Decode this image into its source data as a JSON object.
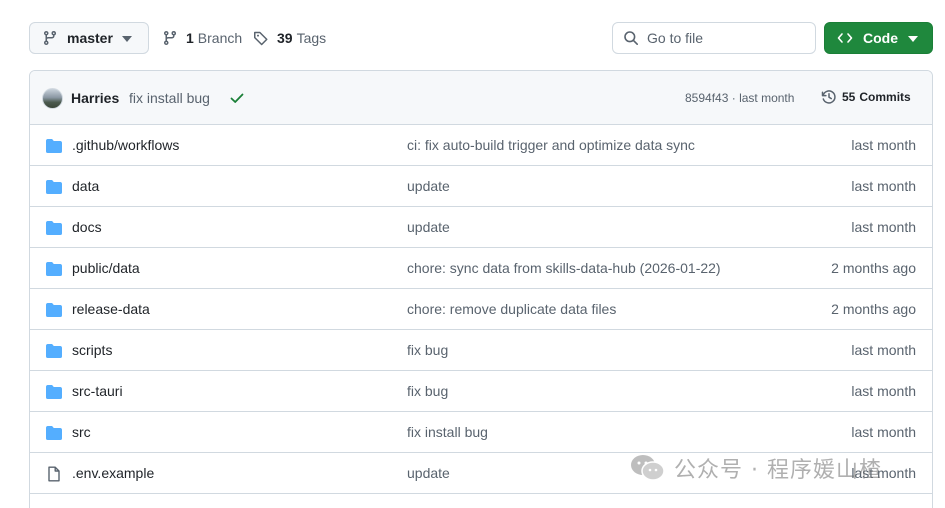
{
  "toolbar": {
    "branch_name": "master",
    "branch_count": "1",
    "branch_label": "Branch",
    "tag_count": "39",
    "tag_label": "Tags",
    "search_placeholder": "Go to file",
    "code_label": "Code"
  },
  "latest_commit": {
    "author": "Harries",
    "message": "fix install bug",
    "hash": "8594f43",
    "separator": "·",
    "time": "last month",
    "commit_count": "55",
    "commit_label": "Commits"
  },
  "files": [
    {
      "name": ".github/workflows",
      "type": "folder",
      "message": "ci: fix auto-build trigger and optimize data sync",
      "time": "last month"
    },
    {
      "name": "data",
      "type": "folder",
      "message": "update",
      "time": "last month"
    },
    {
      "name": "docs",
      "type": "folder",
      "message": "update",
      "time": "last month"
    },
    {
      "name": "public/data",
      "type": "folder",
      "message": "chore: sync data from skills-data-hub (2026-01-22)",
      "time": "2 months ago"
    },
    {
      "name": "release-data",
      "type": "folder",
      "message": "chore: remove duplicate data files",
      "time": "2 months ago"
    },
    {
      "name": "scripts",
      "type": "folder",
      "message": "fix bug",
      "time": "last month"
    },
    {
      "name": "src-tauri",
      "type": "folder",
      "message": "fix bug",
      "time": "last month"
    },
    {
      "name": "src",
      "type": "folder",
      "message": "fix install bug",
      "time": "last month"
    },
    {
      "name": ".env.example",
      "type": "file",
      "message": "update",
      "time": "last month"
    }
  ],
  "watermark": {
    "text": "公众号 · 程序媛山楂"
  },
  "colors": {
    "accent_green": "#1f883d",
    "folder_blue": "#54aeff",
    "muted_text": "#59636e",
    "border": "#d1d9e0"
  }
}
